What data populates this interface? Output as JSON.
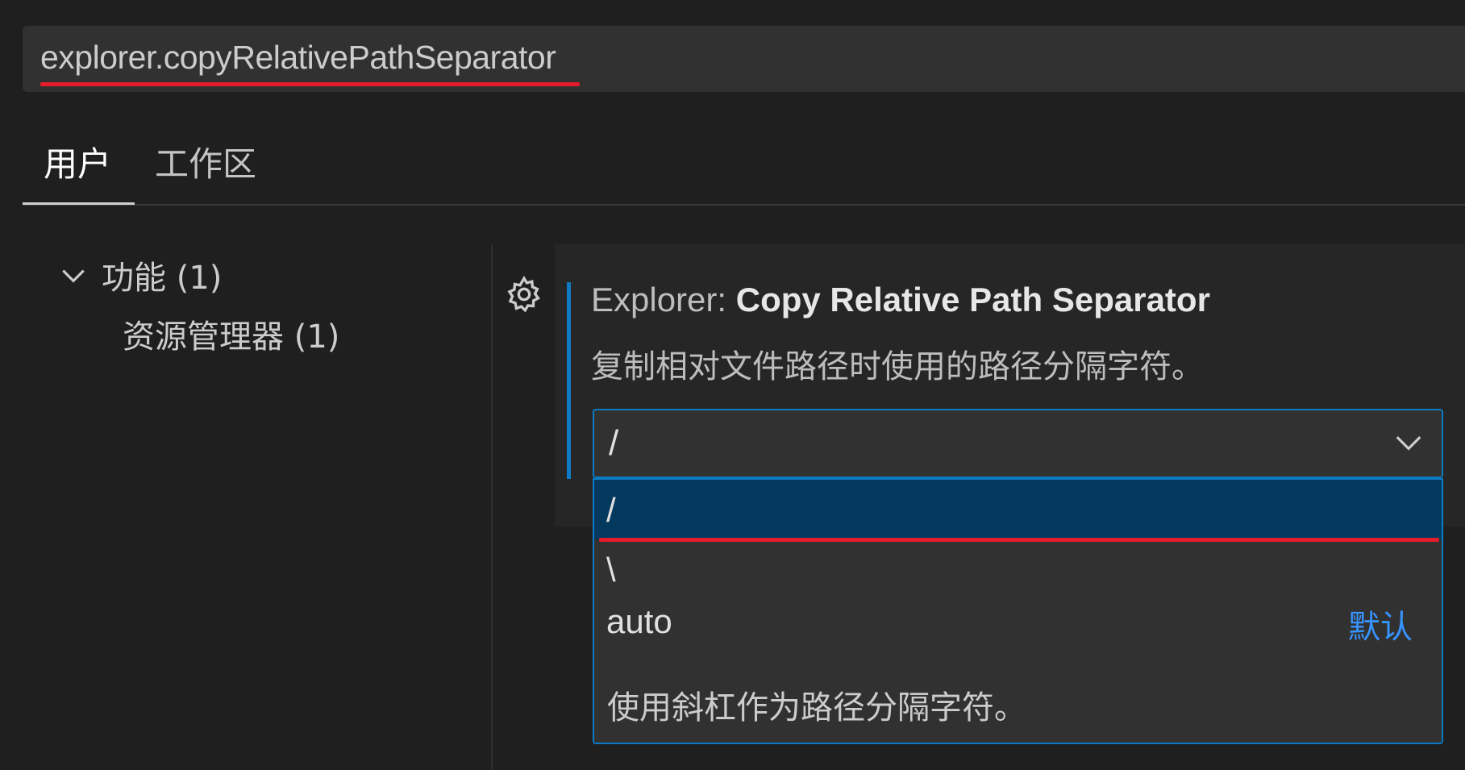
{
  "search": {
    "value": "explorer.copyRelativePathSeparator"
  },
  "tabs": [
    {
      "label": "用户",
      "active": true
    },
    {
      "label": "工作区",
      "active": false
    }
  ],
  "tree": {
    "group_label": "功能 (1)",
    "item_label": "资源管理器 (1)",
    "chevron_icon": "chevron-down-icon"
  },
  "setting": {
    "gear_icon": "gear-icon",
    "category": "Explorer: ",
    "name": "Copy Relative Path Separator",
    "description": "复制相对文件路径时使用的路径分隔字符。",
    "current_value": "/",
    "options": [
      {
        "label": "/",
        "badge": ""
      },
      {
        "label": "\\",
        "badge": ""
      },
      {
        "label": "auto",
        "badge": "默认"
      }
    ],
    "option_description": "使用斜杠作为路径分隔字符。"
  },
  "colors": {
    "accent": "#0e7ac1",
    "highlight_selected": "#04395e",
    "annotation_red": "#e51c2c",
    "badge_blue": "#3794ff"
  }
}
